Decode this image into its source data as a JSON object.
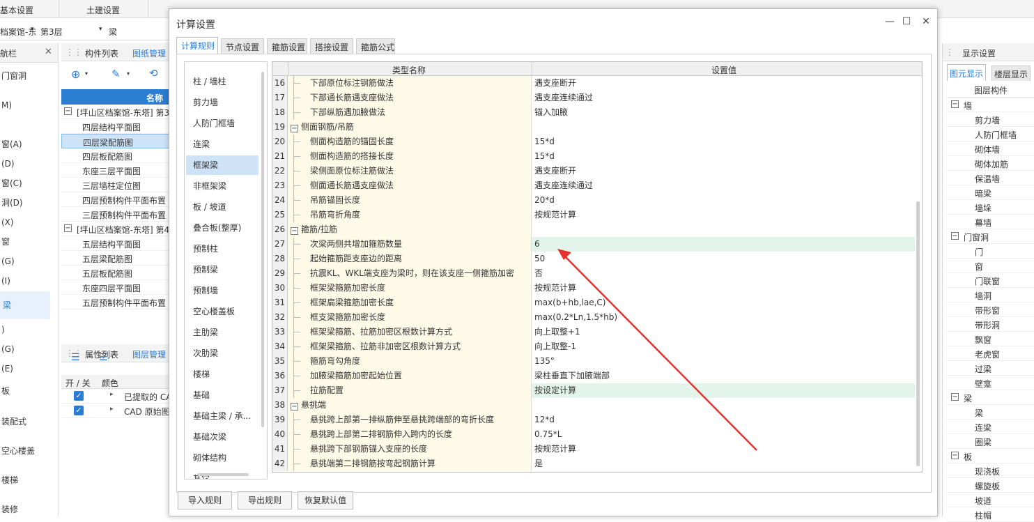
{
  "top_bar": {
    "tab_basic": "基本设置",
    "tab_civil": "土建设置"
  },
  "filter_bar": {
    "project": "档案馆-东",
    "floor": "第3层",
    "type": "梁"
  },
  "left_nav": {
    "title": "航栏",
    "items": [
      "门窗洞",
      "M)",
      "窗(A)",
      "(D)",
      "窗(C)",
      "洞(D)",
      "(X)",
      "窗",
      "(G)",
      "(I)",
      "梁",
      ")",
      "(G)",
      "(E)",
      "板",
      "装配式",
      "空心楼盖",
      "楼梯",
      "装修"
    ]
  },
  "mid_panel": {
    "tab1": "构件列表",
    "tab2": "图纸管理",
    "col_name": "名称",
    "group1": "[坪山区档案馆-东塔] 第3",
    "group1_items": [
      "四层结构平面图",
      "四层梁配筋图",
      "四层板配筋图",
      "东座三层平面图",
      "三层墙柱定位图",
      "四层预制构件平面布置",
      "三层预制构件平面布置"
    ],
    "group2": "[坪山区档案馆-东塔] 第4",
    "group2_items": [
      "五层结构平面图",
      "五层梁配筋图",
      "五层板配筋图",
      "东座四层平面图",
      "五层预制构件平面布置"
    ],
    "prop_tab1": "属性列表",
    "prop_tab2": "图层管理",
    "col_toggle": "开 / 关",
    "col_color": "颜色",
    "layers": [
      "已提取的 CA",
      "CAD 原始图"
    ]
  },
  "right_panel": {
    "title": "显示设置",
    "tab1": "图元显示",
    "tab2": "楼层显示",
    "col": "图层构件",
    "tree": [
      {
        "label": "墙",
        "group": true
      },
      {
        "label": "剪力墙"
      },
      {
        "label": "人防门框墙"
      },
      {
        "label": "砌体墙"
      },
      {
        "label": "砌体加筋"
      },
      {
        "label": "保温墙"
      },
      {
        "label": "暗梁"
      },
      {
        "label": "墙垛"
      },
      {
        "label": "幕墙"
      },
      {
        "label": "门窗洞",
        "group": true
      },
      {
        "label": "门"
      },
      {
        "label": "窗"
      },
      {
        "label": "门联窗"
      },
      {
        "label": "墙洞"
      },
      {
        "label": "带形窗"
      },
      {
        "label": "带形洞"
      },
      {
        "label": "飘窗"
      },
      {
        "label": "老虎窗"
      },
      {
        "label": "过梁"
      },
      {
        "label": "壁龛"
      },
      {
        "label": "梁",
        "group": true
      },
      {
        "label": "梁"
      },
      {
        "label": "连梁"
      },
      {
        "label": "圈梁"
      },
      {
        "label": "板",
        "group": true
      },
      {
        "label": "现浇板"
      },
      {
        "label": "螺旋板"
      },
      {
        "label": "坡道"
      },
      {
        "label": "柱帽"
      }
    ]
  },
  "dialog": {
    "title": "计算设置",
    "tabs": [
      "计算规则",
      "节点设置",
      "箍筋设置",
      "搭接设置",
      "箍筋公式"
    ],
    "categories": [
      "柱 / 墙柱",
      "剪力墙",
      "人防门框墙",
      "连梁",
      "框架梁",
      "非框架梁",
      "板 / 坡道",
      "叠合板(整厚)",
      "预制柱",
      "预制梁",
      "预制墙",
      "空心楼盖板",
      "主肋梁",
      "次肋梁",
      "楼梯",
      "基础",
      "基础主梁 / 承...",
      "基础次梁",
      "砌体结构",
      "其它"
    ],
    "selected_category": 4,
    "grid_header": {
      "name": "类型名称",
      "value": "设置值"
    },
    "rows": [
      {
        "n": "16",
        "name": "下部原位标注钢筋做法",
        "value": "遇支座断开"
      },
      {
        "n": "17",
        "name": "下部通长筋遇支座做法",
        "value": "遇支座连续通过"
      },
      {
        "n": "18",
        "name": "下部纵筋遇加腋做法",
        "value": "锚入加腋"
      },
      {
        "n": "19",
        "name": "侧面钢筋/吊筋",
        "value": "",
        "group": true
      },
      {
        "n": "20",
        "name": "侧面构造筋的锚固长度",
        "value": "15*d"
      },
      {
        "n": "21",
        "name": "侧面构造筋的搭接长度",
        "value": "15*d"
      },
      {
        "n": "22",
        "name": "梁侧面原位标注筋做法",
        "value": "遇支座断开"
      },
      {
        "n": "23",
        "name": "侧面通长筋遇支座做法",
        "value": "遇支座连续通过"
      },
      {
        "n": "24",
        "name": "吊筋锚固长度",
        "value": "20*d"
      },
      {
        "n": "25",
        "name": "吊筋弯折角度",
        "value": "按规范计算"
      },
      {
        "n": "26",
        "name": "箍筋/拉筋",
        "value": "",
        "group": true
      },
      {
        "n": "27",
        "name": "次梁两侧共增加箍筋数量",
        "value": "6",
        "hl": true
      },
      {
        "n": "28",
        "name": "起始箍筋距支座边的距离",
        "value": "50"
      },
      {
        "n": "29",
        "name": "抗震KL、WKL端支座为梁时，则在该支座一侧箍筋加密",
        "value": "否"
      },
      {
        "n": "30",
        "name": "框架梁箍筋加密长度",
        "value": "按规范计算"
      },
      {
        "n": "31",
        "name": "框架扁梁箍筋加密长度",
        "value": "max(b+hb,lae,C)"
      },
      {
        "n": "32",
        "name": "框支梁箍筋加密长度",
        "value": "max(0.2*Ln,1.5*hb)"
      },
      {
        "n": "33",
        "name": "框架梁箍筋、拉筋加密区根数计算方式",
        "value": "向上取整+1"
      },
      {
        "n": "34",
        "name": "框架梁箍筋、拉筋非加密区根数计算方式",
        "value": "向上取整-1"
      },
      {
        "n": "35",
        "name": "箍筋弯勾角度",
        "value": "135°"
      },
      {
        "n": "36",
        "name": "加腋梁箍筋加密起始位置",
        "value": "梁柱垂直下加腋端部"
      },
      {
        "n": "37",
        "name": "拉筋配置",
        "value": "按设定计算",
        "hl": true
      },
      {
        "n": "38",
        "name": "悬挑端",
        "value": "",
        "group": true
      },
      {
        "n": "39",
        "name": "悬挑跨上部第一排纵筋伸至悬挑跨端部的弯折长度",
        "value": "12*d"
      },
      {
        "n": "40",
        "name": "悬挑跨上部第二排钢筋伸入跨内的长度",
        "value": "0.75*L"
      },
      {
        "n": "41",
        "name": "悬挑跨下部钢筋锚入支座的长度",
        "value": "按规范计算"
      },
      {
        "n": "42",
        "name": "悬挑端第二排钢筋按弯起钢筋计算",
        "value": "是"
      }
    ],
    "buttons": {
      "import": "导入规则",
      "export": "导出规则",
      "reset": "恢复默认值"
    },
    "win": {
      "min": "—",
      "max": "☐",
      "close": "✕"
    },
    "expander": "−"
  },
  "colors": {
    "accent": "#2b7cd3",
    "arrow": "#e5322d",
    "highlight": "#e3f4ea",
    "name_cell": "#fdfbe8"
  }
}
